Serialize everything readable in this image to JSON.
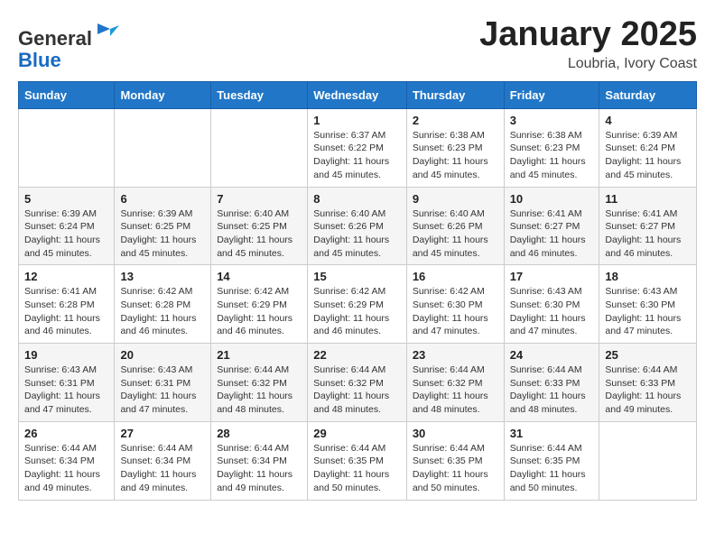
{
  "logo": {
    "general": "General",
    "blue": "Blue"
  },
  "title": {
    "month": "January 2025",
    "location": "Loubria, Ivory Coast"
  },
  "weekdays": [
    "Sunday",
    "Monday",
    "Tuesday",
    "Wednesday",
    "Thursday",
    "Friday",
    "Saturday"
  ],
  "weeks": [
    [
      {
        "day": "",
        "info": ""
      },
      {
        "day": "",
        "info": ""
      },
      {
        "day": "",
        "info": ""
      },
      {
        "day": "1",
        "info": "Sunrise: 6:37 AM\nSunset: 6:22 PM\nDaylight: 11 hours and 45 minutes."
      },
      {
        "day": "2",
        "info": "Sunrise: 6:38 AM\nSunset: 6:23 PM\nDaylight: 11 hours and 45 minutes."
      },
      {
        "day": "3",
        "info": "Sunrise: 6:38 AM\nSunset: 6:23 PM\nDaylight: 11 hours and 45 minutes."
      },
      {
        "day": "4",
        "info": "Sunrise: 6:39 AM\nSunset: 6:24 PM\nDaylight: 11 hours and 45 minutes."
      }
    ],
    [
      {
        "day": "5",
        "info": "Sunrise: 6:39 AM\nSunset: 6:24 PM\nDaylight: 11 hours and 45 minutes."
      },
      {
        "day": "6",
        "info": "Sunrise: 6:39 AM\nSunset: 6:25 PM\nDaylight: 11 hours and 45 minutes."
      },
      {
        "day": "7",
        "info": "Sunrise: 6:40 AM\nSunset: 6:25 PM\nDaylight: 11 hours and 45 minutes."
      },
      {
        "day": "8",
        "info": "Sunrise: 6:40 AM\nSunset: 6:26 PM\nDaylight: 11 hours and 45 minutes."
      },
      {
        "day": "9",
        "info": "Sunrise: 6:40 AM\nSunset: 6:26 PM\nDaylight: 11 hours and 45 minutes."
      },
      {
        "day": "10",
        "info": "Sunrise: 6:41 AM\nSunset: 6:27 PM\nDaylight: 11 hours and 46 minutes."
      },
      {
        "day": "11",
        "info": "Sunrise: 6:41 AM\nSunset: 6:27 PM\nDaylight: 11 hours and 46 minutes."
      }
    ],
    [
      {
        "day": "12",
        "info": "Sunrise: 6:41 AM\nSunset: 6:28 PM\nDaylight: 11 hours and 46 minutes."
      },
      {
        "day": "13",
        "info": "Sunrise: 6:42 AM\nSunset: 6:28 PM\nDaylight: 11 hours and 46 minutes."
      },
      {
        "day": "14",
        "info": "Sunrise: 6:42 AM\nSunset: 6:29 PM\nDaylight: 11 hours and 46 minutes."
      },
      {
        "day": "15",
        "info": "Sunrise: 6:42 AM\nSunset: 6:29 PM\nDaylight: 11 hours and 46 minutes."
      },
      {
        "day": "16",
        "info": "Sunrise: 6:42 AM\nSunset: 6:30 PM\nDaylight: 11 hours and 47 minutes."
      },
      {
        "day": "17",
        "info": "Sunrise: 6:43 AM\nSunset: 6:30 PM\nDaylight: 11 hours and 47 minutes."
      },
      {
        "day": "18",
        "info": "Sunrise: 6:43 AM\nSunset: 6:30 PM\nDaylight: 11 hours and 47 minutes."
      }
    ],
    [
      {
        "day": "19",
        "info": "Sunrise: 6:43 AM\nSunset: 6:31 PM\nDaylight: 11 hours and 47 minutes."
      },
      {
        "day": "20",
        "info": "Sunrise: 6:43 AM\nSunset: 6:31 PM\nDaylight: 11 hours and 47 minutes."
      },
      {
        "day": "21",
        "info": "Sunrise: 6:44 AM\nSunset: 6:32 PM\nDaylight: 11 hours and 48 minutes."
      },
      {
        "day": "22",
        "info": "Sunrise: 6:44 AM\nSunset: 6:32 PM\nDaylight: 11 hours and 48 minutes."
      },
      {
        "day": "23",
        "info": "Sunrise: 6:44 AM\nSunset: 6:32 PM\nDaylight: 11 hours and 48 minutes."
      },
      {
        "day": "24",
        "info": "Sunrise: 6:44 AM\nSunset: 6:33 PM\nDaylight: 11 hours and 48 minutes."
      },
      {
        "day": "25",
        "info": "Sunrise: 6:44 AM\nSunset: 6:33 PM\nDaylight: 11 hours and 49 minutes."
      }
    ],
    [
      {
        "day": "26",
        "info": "Sunrise: 6:44 AM\nSunset: 6:34 PM\nDaylight: 11 hours and 49 minutes."
      },
      {
        "day": "27",
        "info": "Sunrise: 6:44 AM\nSunset: 6:34 PM\nDaylight: 11 hours and 49 minutes."
      },
      {
        "day": "28",
        "info": "Sunrise: 6:44 AM\nSunset: 6:34 PM\nDaylight: 11 hours and 49 minutes."
      },
      {
        "day": "29",
        "info": "Sunrise: 6:44 AM\nSunset: 6:35 PM\nDaylight: 11 hours and 50 minutes."
      },
      {
        "day": "30",
        "info": "Sunrise: 6:44 AM\nSunset: 6:35 PM\nDaylight: 11 hours and 50 minutes."
      },
      {
        "day": "31",
        "info": "Sunrise: 6:44 AM\nSunset: 6:35 PM\nDaylight: 11 hours and 50 minutes."
      },
      {
        "day": "",
        "info": ""
      }
    ]
  ]
}
